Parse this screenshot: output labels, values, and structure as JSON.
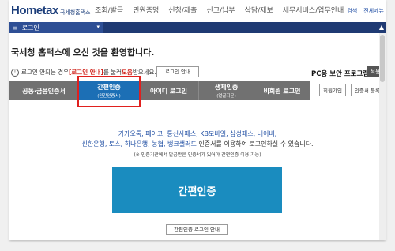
{
  "header": {
    "logo_text": "Hometax",
    "logo_sub": "국세청홈택스",
    "menu": [
      "조회/발급",
      "민원증명",
      "신청/제출",
      "신고/납부",
      "상담/제보",
      "세무서비스/업무안내"
    ],
    "right_links": [
      "검색",
      "전체메뉴"
    ]
  },
  "navbar": {
    "current": "로그인",
    "menu_icon": "≡",
    "chevron": "▾"
  },
  "welcome": "국세청 홈택스에 오신 것을 환영합니다.",
  "notice": {
    "prefix": "로그인 안되는 경우 ",
    "link": "[로그인 안내]",
    "mid": "를 눌러 ",
    "help": "도움",
    "suffix": "받으세요.",
    "button": "로그인 안내"
  },
  "pc_security": {
    "title": "PC용 보안 프로그램",
    "apply": "적용"
  },
  "tabs": [
    {
      "label": "공동·금융인증서",
      "sub": ""
    },
    {
      "label": "간편인증",
      "sub": "(민간인증서)"
    },
    {
      "label": "아이디 로그인",
      "sub": ""
    },
    {
      "label": "생체인증",
      "sub": "(얼굴지문)"
    },
    {
      "label": "비회원 로그인",
      "sub": ""
    }
  ],
  "right_buttons": [
    "회원가입",
    "인증서 등록"
  ],
  "providers_line1": "카카오톡, 페이코, 통신사패스, KB모바일, 삼성패스, 네이버,",
  "providers_line2": "신한은행, 토스, 하나은행, 농협, 뱅크샐러드",
  "desc_suffix": " 인증서를 이용하여 로그인하실 수 있습니다.",
  "desc_note": "(※ 인증기관에서 발급받은 인증서가 있어야 간편인증 이용 가능)",
  "main_button": "간편인증",
  "guide_button": "간편인증 로그인 안내",
  "colors": {
    "navy": "#1f3a73",
    "active_tab": "#1c6fb5",
    "main_button": "#1a8cbf",
    "highlight": "#e0201e"
  }
}
